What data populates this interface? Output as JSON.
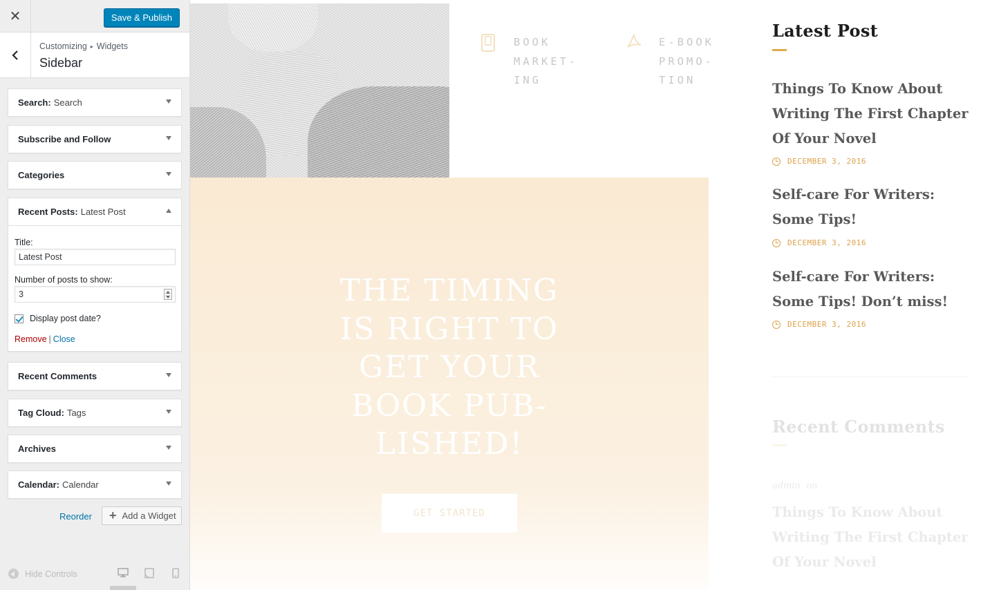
{
  "customizer": {
    "close_symbol": "✕",
    "publish_label": "Save & Publish",
    "breadcrumb": {
      "root": "Customizing",
      "separator": "▸",
      "current": "Widgets"
    },
    "section_title": "Sidebar",
    "widgets": [
      {
        "name": "Search",
        "title": "Search",
        "expanded": false
      },
      {
        "name": "Subscribe and Follow",
        "title": "",
        "expanded": false
      },
      {
        "name": "Categories",
        "title": "",
        "expanded": false
      },
      {
        "name": "Recent Posts",
        "title": "Latest Post",
        "expanded": true
      },
      {
        "name": "Recent Comments",
        "title": "",
        "expanded": false
      },
      {
        "name": "Tag Cloud",
        "title": "Tags",
        "expanded": false
      },
      {
        "name": "Archives",
        "title": "",
        "expanded": false
      },
      {
        "name": "Calendar",
        "title": "Calendar",
        "expanded": false
      }
    ],
    "recent_posts_form": {
      "title_label": "Title:",
      "title_value": "Latest Post",
      "count_label": "Number of posts to show:",
      "count_value": "3",
      "show_date_label": "Display post date?",
      "show_date_checked": true,
      "remove_label": "Remove",
      "separator": "|",
      "close_label": "Close"
    },
    "reorder_label": "Reorder",
    "add_widget_label": "Add a Widget",
    "hide_controls_label": "Hide Controls",
    "devices": [
      "desktop-icon",
      "tablet-icon",
      "mobile-icon"
    ],
    "active_device": "desktop"
  },
  "preview": {
    "features": [
      {
        "icon": "book-icon",
        "label": "BOOK MARKET-ING"
      },
      {
        "icon": "pdf-icon",
        "label": "E-BOOK PROMO-TION"
      }
    ],
    "hero": {
      "title": "THE TIMING IS RIGHT TO GET YOUR BOOK PUB-LISHED!",
      "button_label": "GET STARTED"
    },
    "latest_post": {
      "heading": "Latest Post",
      "posts": [
        {
          "title": "Things To Know About Writing The First Chapter Of Your Novel",
          "date": "DECEMBER 3, 2016"
        },
        {
          "title": "Self-care For Writers: Some Tips!",
          "date": "DECEMBER 3, 2016"
        },
        {
          "title": "Self-care For Writers: Some Tips! Don’t miss!",
          "date": "DECEMBER 3, 2016"
        }
      ]
    },
    "recent_comments": {
      "heading": "Recent Comments",
      "meta": "admin  on",
      "post_title": "Things To Know About Writing The First Chapter Of Your Novel"
    },
    "colors": {
      "accent": "#dca24b",
      "hero_bg": "#faead3",
      "publish_blue": "#0085ba"
    }
  }
}
